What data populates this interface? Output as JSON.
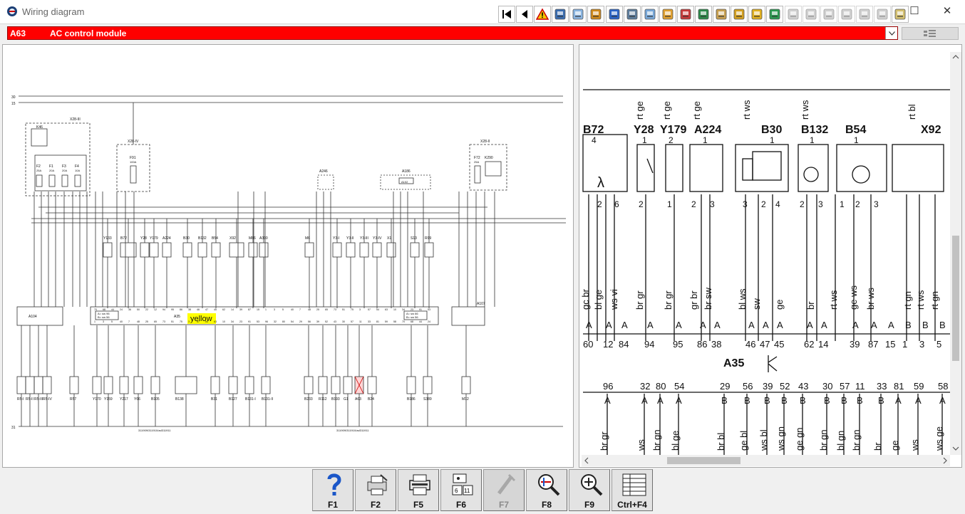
{
  "window": {
    "title": "Wiring diagram"
  },
  "toolbar": {
    "buttons": [
      "first-page-icon",
      "previous-page-icon",
      "warning-icon",
      "component-icon",
      "signal-icon",
      "ground-icon",
      "connector-icon",
      "gauge-icon",
      "harness-icon",
      "relay-icon",
      "fuse-icon",
      "install-icon",
      "location-icon",
      "person-icon",
      "tools-icon",
      "print-icon",
      "gray-icon-1",
      "gray-icon-2",
      "gray-icon-3",
      "gray-icon-4",
      "gray-icon-5",
      "gray-icon-6",
      "exit-icon"
    ]
  },
  "module": {
    "code": "A63",
    "name": "AC control module"
  },
  "left_diagram": {
    "top_rails": [
      "30",
      "15"
    ],
    "bottom_rail": "31",
    "fuse_box": "X28-III",
    "relay": "K46",
    "fuses": [
      {
        "id": "F2",
        "amp": "25A"
      },
      {
        "id": "F1",
        "amp": "20A"
      },
      {
        "id": "F3",
        "amp": "20A"
      },
      {
        "id": "F4",
        "amp": "10A"
      }
    ],
    "fuse_f91": {
      "id": "F91",
      "amp": "100A",
      "box": "X28-IV"
    },
    "fuse_box2": "X28-II",
    "fuse_f72": {
      "id": "F72",
      "amp": "25A"
    },
    "relay_k290": "K290",
    "components_top": [
      "Y133",
      "B72",
      "Y28",
      "Y179",
      "A224",
      "B30",
      "B132",
      "B54",
      "X92",
      "M86",
      "A300",
      "M6",
      "Y3-I",
      "Y3-II",
      "Y3-III",
      "Y3-IV",
      "X1",
      "S13",
      "R99",
      "A246",
      "A186",
      "A102"
    ],
    "a35": {
      "label": "A35",
      "highlight": "yellow",
      "notes_left": [
        "A= sw 96",
        "B= sw 56"
      ],
      "notes_right": [
        "A= sw 66",
        "B= sw 56"
      ]
    },
    "a104": "A104",
    "a107": "A107",
    "components_bottom": [
      "R5-I",
      "R5-II",
      "R5-III",
      "R5-IV",
      "R57",
      "Y170",
      "Y159",
      "Y217",
      "Y66",
      "B105",
      "B138",
      "B31",
      "B127",
      "B131-I",
      "B131-II",
      "B233",
      "R112",
      "B193",
      "G1",
      "A63",
      "B24",
      "B186",
      "S389",
      "M12"
    ],
    "refs": [
      "311909/311910/ad311911",
      "311909/311910/ad311911"
    ],
    "pin_ids": [
      "70",
      "68",
      "44",
      "24",
      "36",
      "50",
      "22",
      "12",
      "94",
      "95",
      "86",
      "38",
      "46",
      "47",
      "45",
      "62",
      "14",
      "39",
      "87",
      "15",
      "1",
      "3",
      "5",
      "40",
      "7",
      "48",
      "25",
      "65",
      "73",
      "51",
      "75",
      "3",
      "57",
      "54",
      "63",
      "10",
      "34",
      "23",
      "91",
      "53",
      "96",
      "32",
      "80",
      "54",
      "29",
      "56",
      "39",
      "52",
      "43",
      "30",
      "57",
      "11",
      "33",
      "81",
      "59",
      "58"
    ]
  },
  "right_diagram": {
    "components": [
      {
        "id": "B72",
        "pins": [
          "2",
          "6"
        ],
        "top_pin": "4"
      },
      {
        "id": "Y28",
        "pins": [
          "2"
        ],
        "top_pin": "1"
      },
      {
        "id": "Y179",
        "pins": [
          "1"
        ],
        "top_pin": "2"
      },
      {
        "id": "A224",
        "pins": [
          "2",
          "3"
        ],
        "top_pin": "1"
      },
      {
        "id": "B30",
        "pins": [
          "3",
          "2",
          "4"
        ],
        "top_pin": "1"
      },
      {
        "id": "B132",
        "pins": [
          "2",
          "3"
        ],
        "top_pin": "1"
      },
      {
        "id": "B54",
        "pins": [
          "1",
          "2",
          "3"
        ],
        "top_pin": "1"
      },
      {
        "id": "X92",
        "pins": [],
        "top_pin": ""
      }
    ],
    "top_wire_labels": [
      "rt ge",
      "rt ge",
      "rt ge",
      "rt ws",
      "rt ws",
      "rt bl"
    ],
    "wire_colors_upper": [
      "gc br",
      "bl ge",
      "ws vi",
      "br gr",
      "br gr",
      "gr br",
      "br sw",
      "bl ws",
      "sw",
      "ge",
      "br",
      "rt ws",
      "ge ws",
      "br ws",
      "rt gn",
      "rt ws",
      "rt gn"
    ],
    "upper_pin_letters": [
      "A",
      "A",
      "A",
      "A",
      "A",
      "A",
      "A",
      "A",
      "A",
      "A",
      "A",
      "A",
      "A",
      "A",
      "A",
      "B",
      "B",
      "B"
    ],
    "upper_pins": [
      "60",
      "12",
      "84",
      "94",
      "95",
      "86",
      "38",
      "46",
      "47",
      "45",
      "62",
      "14",
      "39",
      "87",
      "15",
      "1",
      "3",
      "5"
    ],
    "a35": "A35",
    "lower_pins": [
      "96",
      "32",
      "80",
      "54",
      "29",
      "56",
      "39",
      "52",
      "43",
      "30",
      "57",
      "11",
      "33",
      "81",
      "59",
      "58"
    ],
    "lower_pin_letters": [
      "A",
      "A",
      "A",
      "A",
      "B",
      "B",
      "B",
      "B",
      "B",
      "B",
      "B",
      "B",
      "B",
      "A",
      "A",
      "A"
    ],
    "wire_colors_lower": [
      "br gr",
      "ws",
      "br gn",
      "bl ge",
      "br bl",
      "ge bl",
      "ws bl",
      "ws gn",
      "ge gn",
      "br gn",
      "bl gn",
      "br gn",
      "br",
      "ge",
      "ws",
      "ws ge"
    ]
  },
  "function_keys": [
    {
      "key": "F1",
      "icon": "help-icon",
      "enabled": true
    },
    {
      "key": "F2",
      "icon": "printer-setup-icon",
      "enabled": true
    },
    {
      "key": "F5",
      "icon": "print-icon",
      "enabled": true
    },
    {
      "key": "F6",
      "icon": "page-numbers-icon",
      "enabled": true
    },
    {
      "key": "F7",
      "icon": "disabled-tool-icon",
      "enabled": false
    },
    {
      "key": "F8",
      "icon": "search-signal-icon",
      "enabled": true
    },
    {
      "key": "F9",
      "icon": "zoom-icon",
      "enabled": true
    },
    {
      "key": "Ctrl+F4",
      "icon": "list-view-icon",
      "enabled": true
    }
  ]
}
